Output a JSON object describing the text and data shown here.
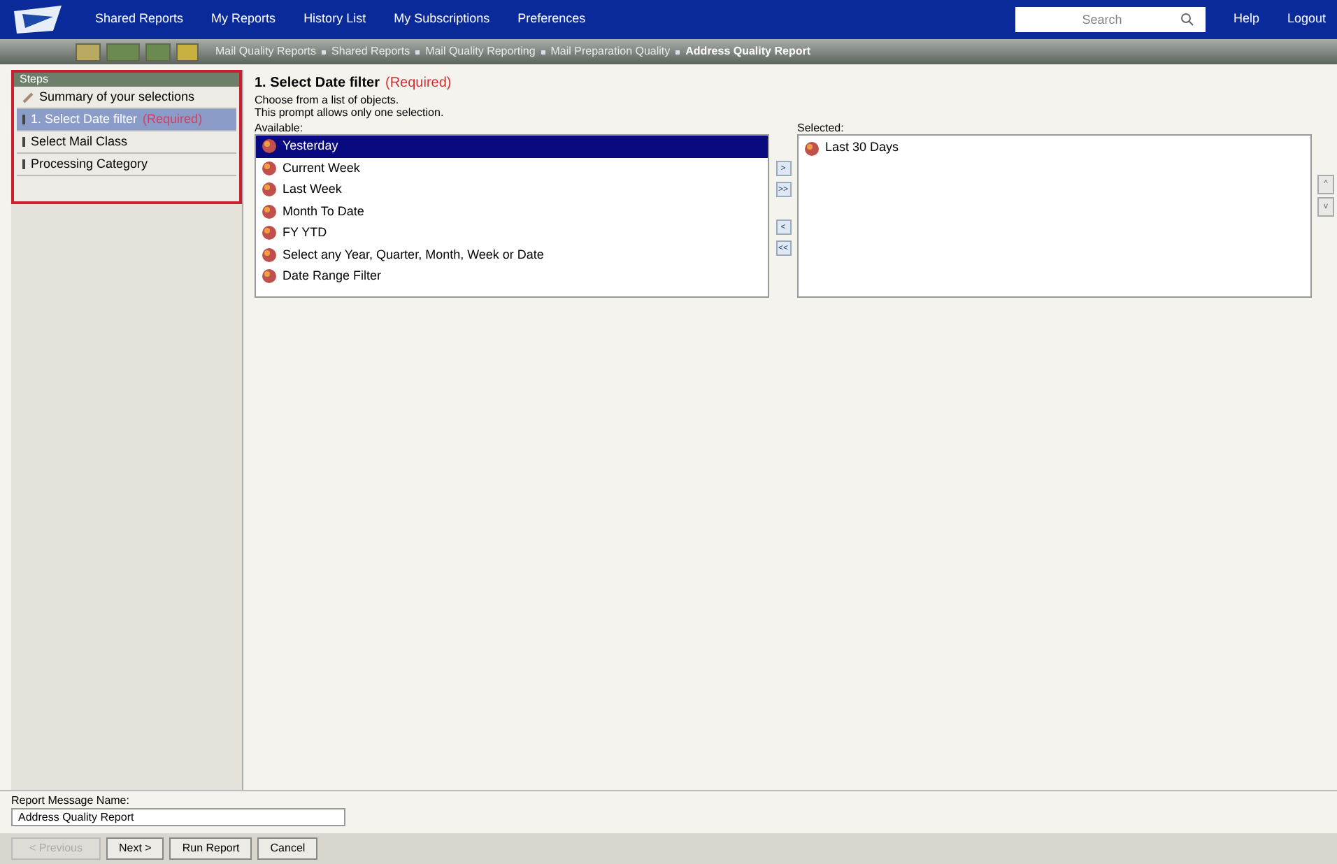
{
  "top_nav": {
    "items": [
      "Shared Reports",
      "My Reports",
      "History List",
      "My Subscriptions",
      "Preferences"
    ],
    "search": {
      "placeholder": "Search"
    },
    "links": [
      "Help",
      "Logout"
    ]
  },
  "breadcrumb": [
    "Mail Quality Reports",
    "Shared Reports",
    "Mail Quality Reporting",
    "Mail Preparation Quality",
    "Address Quality Report"
  ],
  "steps_panel": {
    "title": "Steps",
    "items": [
      {
        "kind": "summary",
        "label": "Summary of your selections",
        "selected": false
      },
      {
        "kind": "step",
        "label": "1. Select Date filter",
        "required": "(Required)",
        "selected": true
      },
      {
        "kind": "step",
        "label": "Select Mail Class",
        "selected": false
      },
      {
        "kind": "step",
        "label": "Processing Category",
        "selected": false
      }
    ]
  },
  "prompt": {
    "title": "1. Select Date filter",
    "required": "(Required)",
    "lines": [
      "Choose from a list of objects.",
      "This prompt allows only one selection."
    ],
    "available": {
      "label": "Available:",
      "items": [
        {
          "label": "Yesterday",
          "selected": true
        },
        {
          "label": "Current Week",
          "selected": false
        },
        {
          "label": "Last Week",
          "selected": false
        },
        {
          "label": "Month To Date",
          "selected": false
        },
        {
          "label": "FY YTD",
          "selected": false
        },
        {
          "label": "Select any Year, Quarter, Month, Week or Date",
          "selected": false
        },
        {
          "label": "Date Range Filter",
          "selected": false
        }
      ]
    },
    "move_buttons": [
      ">",
      ">>",
      "<",
      "<<"
    ],
    "selected": {
      "label": "Selected:",
      "items": [
        "Last 30 Days"
      ]
    },
    "order_buttons": [
      "^",
      "v"
    ]
  },
  "footer": {
    "message_label": "Report Message Name:",
    "message_value": "Address Quality Report",
    "buttons": [
      {
        "label": "< Previous",
        "disabled": true
      },
      {
        "label": "Next >",
        "disabled": false
      },
      {
        "label": "Run Report",
        "disabled": false
      },
      {
        "label": "Cancel",
        "disabled": false
      }
    ]
  }
}
